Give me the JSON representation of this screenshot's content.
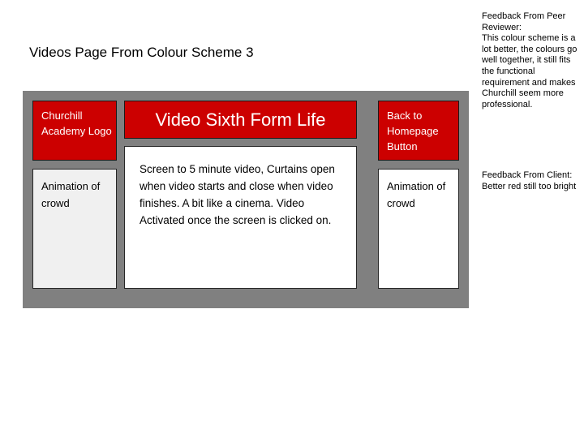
{
  "slide": {
    "title": "Videos Page From Colour Scheme 3"
  },
  "colors": {
    "brand_red": "#CC0000",
    "frame_grey": "#808080",
    "panel_grey": "#f0f0f0",
    "panel_white": "#ffffff",
    "text_dark": "#000000",
    "text_light": "#ffffff"
  },
  "mockup": {
    "left_column": {
      "logo_placeholder": "Churchill Academy Logo",
      "animation_placeholder": "Animation of crowd"
    },
    "centre_column": {
      "heading": "Video Sixth Form Life",
      "description": "Screen to 5 minute video, Curtains open when video starts and close when video finishes. A bit like a cinema. Video Activated once the screen is clicked on."
    },
    "right_column": {
      "back_button": "Back to Homepage Button",
      "animation_placeholder": "Animation of crowd"
    }
  },
  "feedback": {
    "peer": {
      "label": "Feedback From Peer Reviewer:",
      "body": " This colour scheme is a lot better, the colours go well together, it still fits the functional requirement and makes Churchill seem more professional."
    },
    "client": {
      "label": "Feedback From Client:",
      "body": "Better red still too bright"
    }
  }
}
